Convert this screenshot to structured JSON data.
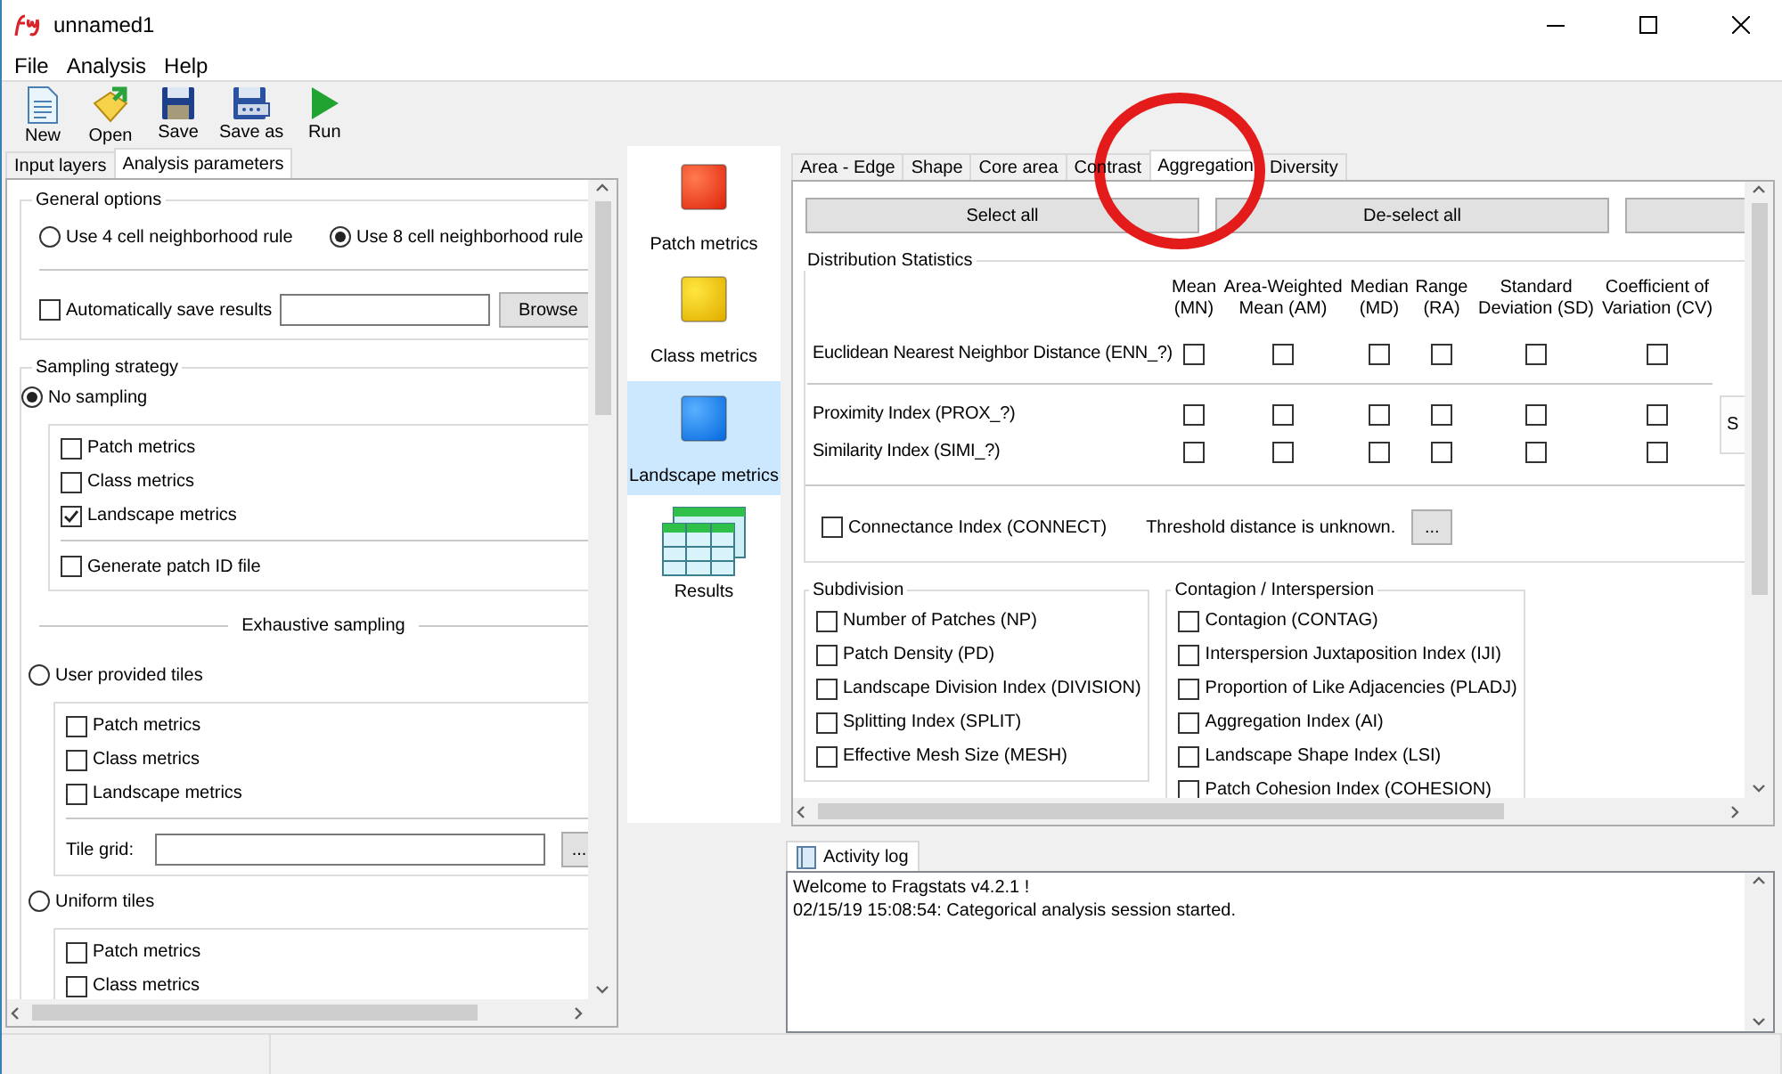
{
  "window": {
    "title": "unnamed1"
  },
  "menu": [
    "File",
    "Analysis",
    "Help"
  ],
  "toolbar": [
    {
      "label": "New",
      "kind": "new"
    },
    {
      "label": "Open",
      "kind": "open"
    },
    {
      "label": "Save",
      "kind": "save"
    },
    {
      "label": "Save as",
      "kind": "saveas"
    },
    {
      "label": "Run",
      "kind": "run"
    }
  ],
  "left_tabs": [
    {
      "label": "Input layers",
      "selected": false
    },
    {
      "label": "Analysis parameters",
      "selected": true
    }
  ],
  "general_options": {
    "title": "General options",
    "neighborhood": [
      {
        "label": "Use 4 cell neighborhood rule",
        "selected": false
      },
      {
        "label": "Use 8 cell neighborhood rule",
        "selected": true
      }
    ],
    "auto_save": {
      "label": "Automatically save results",
      "checked": false
    },
    "browse_button": "Browse"
  },
  "sampling": {
    "title": "Sampling strategy",
    "exhaustive_heading": "Exhaustive sampling",
    "strategies": [
      {
        "label": "No sampling",
        "selected": true,
        "options": [
          {
            "label": "Patch metrics",
            "checked": false
          },
          {
            "label": "Class metrics",
            "checked": false
          },
          {
            "label": "Landscape metrics",
            "checked": true
          }
        ],
        "extras": [
          {
            "label": "Generate patch ID file",
            "checked": false
          }
        ]
      },
      {
        "label": "User provided tiles",
        "selected": false,
        "options": [
          {
            "label": "Patch metrics",
            "checked": false
          },
          {
            "label": "Class metrics",
            "checked": false
          },
          {
            "label": "Landscape metrics",
            "checked": false
          }
        ],
        "tile_grid": {
          "label": "Tile grid:",
          "button": "..."
        }
      },
      {
        "label": "Uniform tiles",
        "selected": false,
        "options": [
          {
            "label": "Patch metrics",
            "checked": false
          },
          {
            "label": "Class metrics",
            "checked": false
          }
        ]
      }
    ]
  },
  "nav": [
    {
      "label": "Patch metrics",
      "kind": "patch",
      "selected": false
    },
    {
      "label": "Class metrics",
      "kind": "class",
      "selected": false
    },
    {
      "label": "Landscape metrics",
      "kind": "landscape",
      "selected": true
    },
    {
      "label": "Results",
      "kind": "results",
      "selected": false
    }
  ],
  "metric_tabs": [
    {
      "label": "Area - Edge",
      "selected": false
    },
    {
      "label": "Shape",
      "selected": false
    },
    {
      "label": "Core area",
      "selected": false
    },
    {
      "label": "Contrast",
      "selected": false
    },
    {
      "label": "Aggregation",
      "selected": true
    },
    {
      "label": "Diversity",
      "selected": false
    }
  ],
  "action_buttons": [
    "Select all",
    "De-select all"
  ],
  "distribution": {
    "title": "Distribution Statistics",
    "columns": [
      [
        "Mean",
        "(MN)"
      ],
      [
        "Area-Weighted",
        "Mean (AM)"
      ],
      [
        "Median",
        "(MD)"
      ],
      [
        "Range",
        "(RA)"
      ],
      [
        "Standard",
        "Deviation (SD)"
      ],
      [
        "Coefficient of",
        "Variation (CV)"
      ]
    ],
    "rows": [
      {
        "label": "Euclidean Nearest Neighbor Distance (ENN_?)",
        "divider_below": true,
        "checks": [
          false,
          false,
          false,
          false,
          false,
          false
        ]
      },
      {
        "label": "Proximity Index (PROX_?)",
        "divider_below": false,
        "checks": [
          false,
          false,
          false,
          false,
          false,
          false
        ]
      },
      {
        "label": "Similarity Index (SIMI_?)",
        "divider_below": false,
        "checks": [
          false,
          false,
          false,
          false,
          false,
          false
        ]
      }
    ],
    "side_button": "S",
    "connectance": {
      "label": "Connectance Index (CONNECT)",
      "checked": false,
      "note": "Threshold distance is unknown.",
      "button": "..."
    }
  },
  "subdivision": {
    "title": "Subdivision",
    "items": [
      {
        "label": "Number of Patches (NP)",
        "checked": false
      },
      {
        "label": "Patch Density (PD)",
        "checked": false
      },
      {
        "label": "Landscape Division Index (DIVISION)",
        "checked": false
      },
      {
        "label": "Splitting Index (SPLIT)",
        "checked": false
      },
      {
        "label": "Effective Mesh Size (MESH)",
        "checked": false
      }
    ]
  },
  "contagion": {
    "title": "Contagion / Interspersion",
    "items": [
      {
        "label": "Contagion (CONTAG)",
        "checked": false
      },
      {
        "label": "Interspersion Juxtaposition Index (IJI)",
        "checked": false
      },
      {
        "label": "Proportion of Like Adjacencies (PLADJ)",
        "checked": false
      },
      {
        "label": "Aggregation Index (AI)",
        "checked": false
      },
      {
        "label": "Landscape Shape Index (LSI)",
        "checked": false
      },
      {
        "label": "Patch Cohesion Index (COHESION)",
        "checked": false
      }
    ]
  },
  "activity_log": {
    "tab": "Activity log",
    "lines": [
      "Welcome to Fragstats v4.2.1 !",
      "02/15/19 15:08:54: Categorical analysis session started."
    ]
  }
}
